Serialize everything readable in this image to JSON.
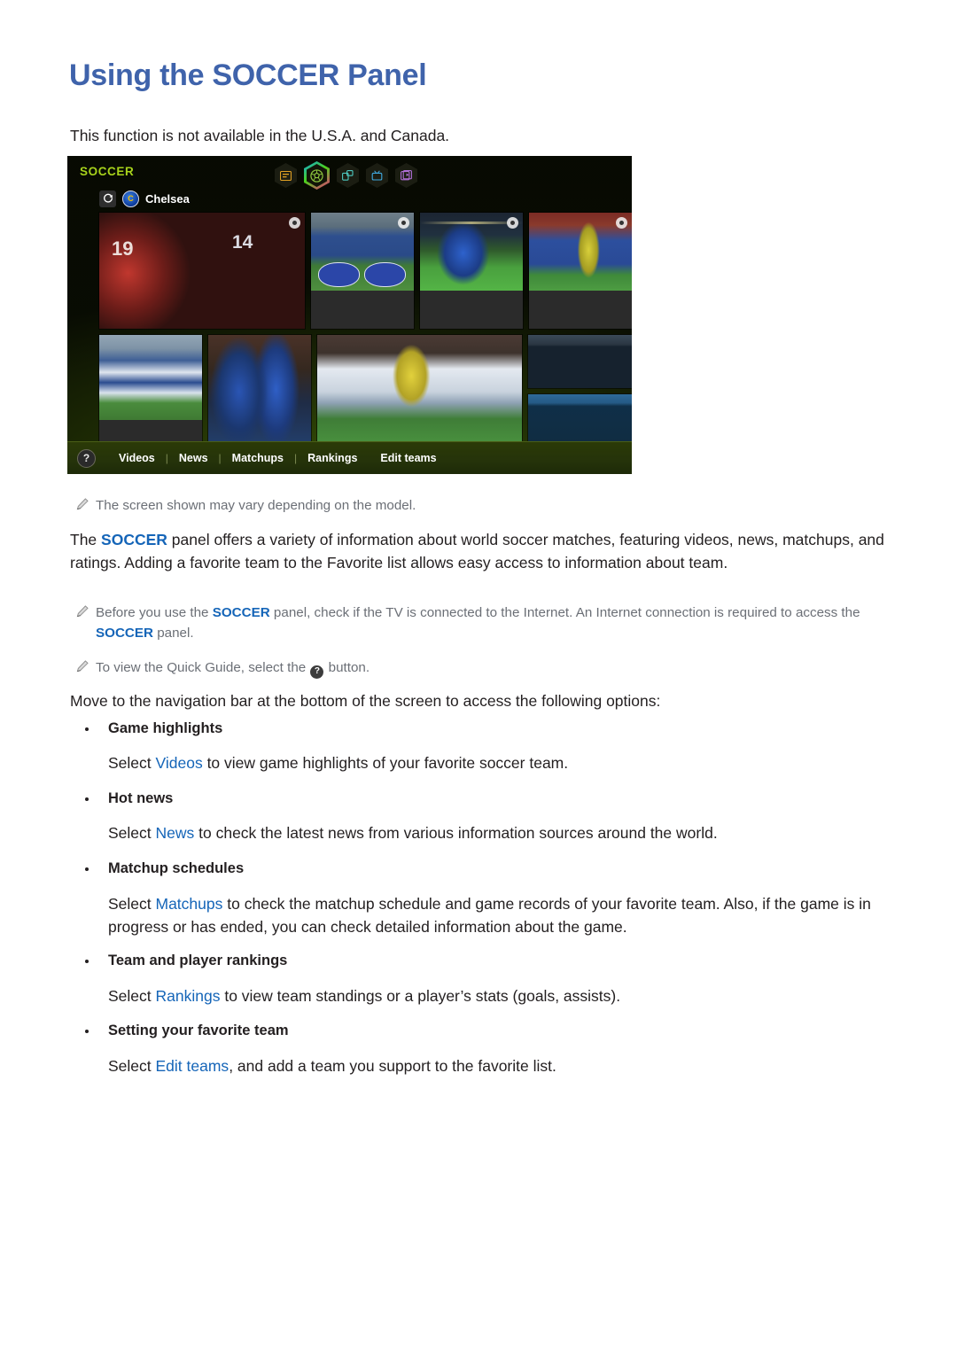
{
  "document": {
    "title": "Using the SOCCER Panel",
    "intro": "This function is not available in the U.S.A. and Canada.",
    "title_color": "#3f63ab",
    "link_color": "#1565b8"
  },
  "tv_panel": {
    "logo": "SOCCER",
    "logo_color": "#a7d21b",
    "icons": [
      {
        "name": "list-panel-icon",
        "color": "#e0a023"
      },
      {
        "name": "soccer-ball-icon",
        "color": "#8ec63f",
        "selected": true
      },
      {
        "name": "apps-panel-icon",
        "color": "#4ec9c0"
      },
      {
        "name": "tv-panel-icon",
        "color": "#3fa9e0"
      },
      {
        "name": "media-panel-icon",
        "color": "#b06fd8"
      }
    ],
    "favorite_team": {
      "refresh_label": "refresh",
      "badge_label": "C",
      "name": "Chelsea"
    },
    "nav": {
      "help_label": "?",
      "items": [
        "Videos",
        "News",
        "Matchups",
        "Rankings",
        "Edit teams"
      ]
    },
    "tiles": {
      "row1": [
        "chelsea-vs-united-match",
        "team-lineup-banners",
        "player-celebration",
        "teams-lining-up"
      ],
      "row2": [
        "squad-photo-stadium",
        "match-action-duel",
        "uefa-team-photo",
        "empty-slot-dark",
        "empty-slot-blue"
      ]
    }
  },
  "notes": {
    "screen_vary": "The screen shown may vary depending on the model.",
    "internet_pre": "Before you use the ",
    "internet_kw1": "SOCCER",
    "internet_mid": " panel, check if the TV is connected to the Internet. An Internet connection is required to access the ",
    "internet_kw2": "SOCCER",
    "internet_post": " panel.",
    "quick_guide_pre": "To view the Quick Guide, select the ",
    "quick_guide_badge": "?",
    "quick_guide_post": " button."
  },
  "main_paragraph": {
    "p1": "The ",
    "kw": "SOCCER",
    "p2": " panel offers a variety of information about world soccer matches, featuring videos, news, matchups, and ratings. Adding a favorite team to the Favorite list allows easy access to information about team."
  },
  "nav_intro": "Move to the navigation bar at the bottom of the screen to access the following options:",
  "options": [
    {
      "title": "Game highlights",
      "body_pre": "Select ",
      "link": "Videos",
      "body_post": " to view game highlights of your favorite soccer team."
    },
    {
      "title": "Hot news",
      "body_pre": "Select ",
      "link": "News",
      "body_post": " to check the latest news from various information sources around the world."
    },
    {
      "title": "Matchup schedules",
      "body_pre": "Select ",
      "link": "Matchups",
      "body_post": " to check the matchup schedule and game records of your favorite team. Also, if the game is in progress or has ended, you can check detailed information about the game."
    },
    {
      "title": "Team and player rankings",
      "body_pre": "Select ",
      "link": "Rankings",
      "body_post": " to view team standings or a player’s stats (goals, assists)."
    },
    {
      "title": "Setting your favorite team",
      "body_pre": "Select ",
      "link": "Edit teams",
      "body_post": ", and add a team you support to the favorite list."
    }
  ]
}
